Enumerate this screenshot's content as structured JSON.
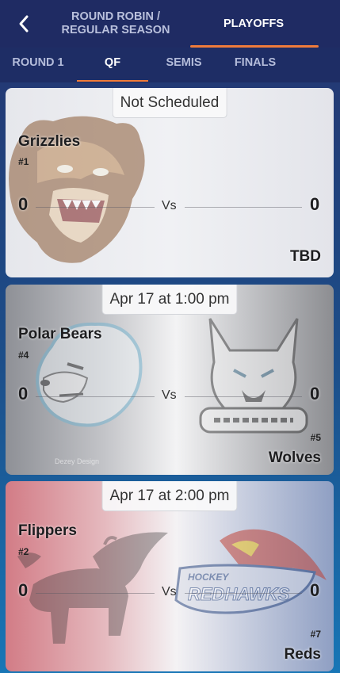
{
  "header": {
    "back_icon": "chevron-left-icon",
    "tabs": [
      {
        "label": "ROUND ROBIN / REGULAR SEASON",
        "line1": "ROUND ROBIN /",
        "line2": "REGULAR SEASON",
        "active": false
      },
      {
        "label": "PLAYOFFS",
        "active": true
      }
    ],
    "accent_color": "#f07b3a"
  },
  "subtabs": [
    {
      "label": "ROUND 1",
      "active": false
    },
    {
      "label": "QF",
      "active": true
    },
    {
      "label": "SEMIS",
      "active": false
    },
    {
      "label": "FINALS",
      "active": false
    }
  ],
  "games": [
    {
      "status": "Not Scheduled",
      "home": {
        "name": "Grizzlies",
        "seed": "#1",
        "score": "0",
        "logo": "grizzly-bear-logo"
      },
      "vs": "Vs",
      "away": {
        "name": "TBD",
        "seed": "",
        "score": "0",
        "logo": ""
      }
    },
    {
      "status": "Apr 17 at 1:00 pm",
      "home": {
        "name": "Polar Bears",
        "seed": "#4",
        "score": "0",
        "logo": "polar-bear-logo"
      },
      "vs": "Vs",
      "away": {
        "name": "Wolves",
        "seed": "#5",
        "score": "0",
        "logo": "wolf-logo"
      },
      "credit": "Dezey Design"
    },
    {
      "status": "Apr 17 at 2:00 pm",
      "home": {
        "name": "Flippers",
        "seed": "#2",
        "score": "0",
        "logo": "winged-bull-logo"
      },
      "vs": "Vs",
      "away": {
        "name": "Reds",
        "seed": "#7",
        "score": "0",
        "logo": "redhawk-logo"
      },
      "away_logo_text": {
        "top": "HOCKEY",
        "main": "REDHAWKS"
      }
    }
  ]
}
